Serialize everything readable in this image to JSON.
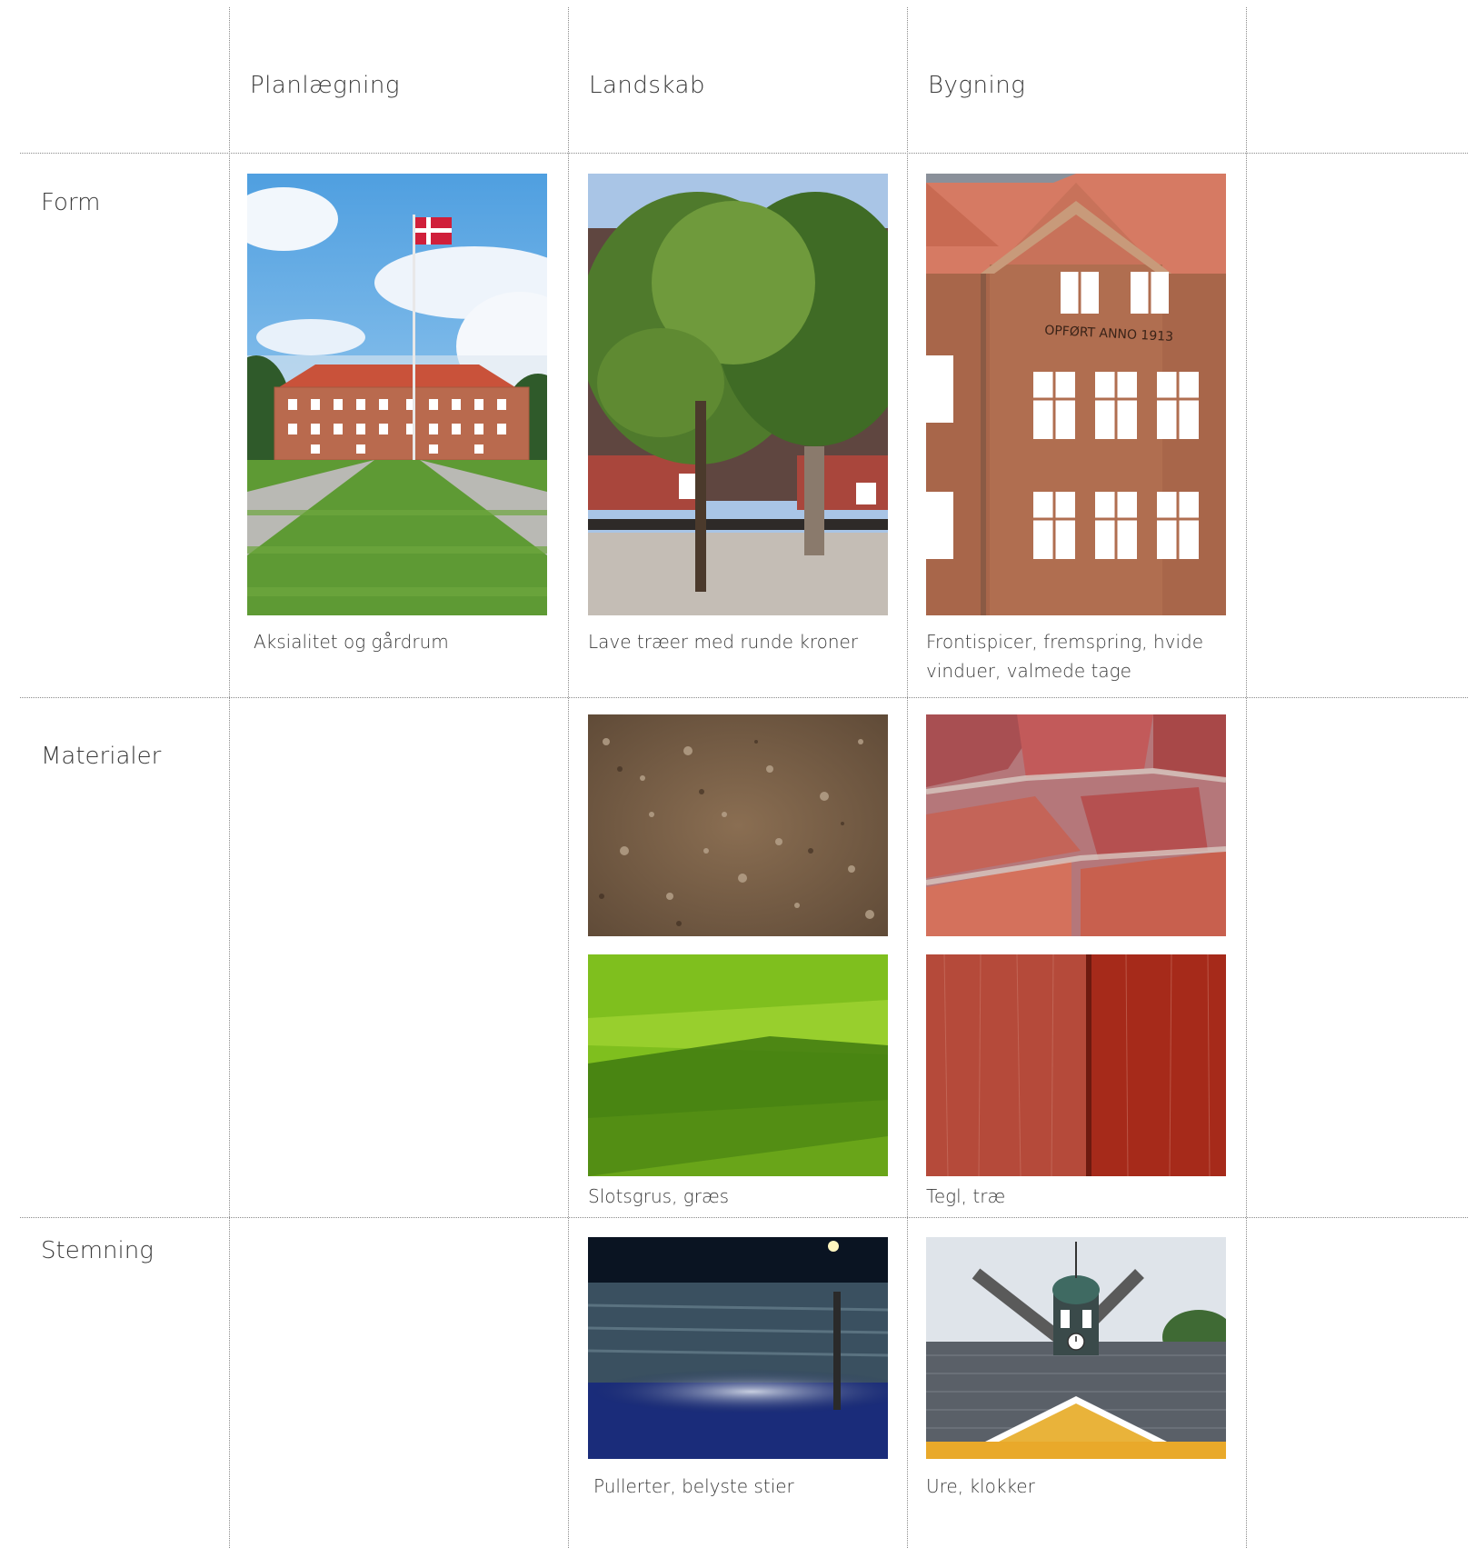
{
  "columns": [
    "Planlægning",
    "Landskab",
    "Bygning"
  ],
  "rows": [
    "Form",
    "Materialer",
    "Stemning"
  ],
  "images": {
    "form_planlaegning": "courtyard-building-flag-photo",
    "form_landskab": "round-crowned-tree-photo",
    "form_bygning": "brick-facade-frontispiece-photo",
    "materialer_landskab_1": "gravel-texture-photo",
    "materialer_landskab_2": "grass-texture-photo",
    "materialer_bygning_1": "brick-wall-texture-photo",
    "materialer_bygning_2": "red-wood-texture-photo",
    "stemning_landskab": "illuminated-path-bollard-photo",
    "stemning_bygning": "clock-tower-roof-photo"
  },
  "facade_inscription": "OPFØRT ANNO 1913",
  "captions": {
    "form_planlaegning": "Aksialitet og gårdrum",
    "form_landskab": "Lave træer med runde kroner",
    "form_bygning_line1": "Frontispicer, fremspring, hvide",
    "form_bygning_line2": "vinduer, valmede tage",
    "materialer_landskab": "Slotsgrus, græs",
    "materialer_bygning": "Tegl, træ",
    "stemning_landskab": "Pullerter, belyste stier",
    "stemning_bygning": "Ure, klokker"
  }
}
